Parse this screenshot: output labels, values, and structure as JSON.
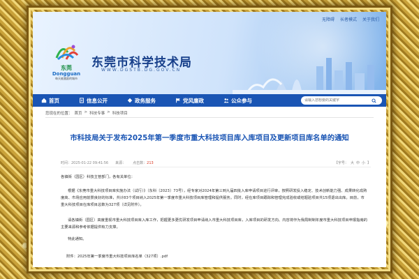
{
  "header": {
    "top_links": [
      "无障碍",
      "长者模式",
      "关于我们"
    ],
    "logo_city": "东莞",
    "logo_en": "Dongguan",
    "logo_slogan": "每天被激励的城市",
    "site_title": "东莞市科学技术局",
    "site_domain": "WWW.DGSTB.DG.GOV.CN"
  },
  "nav": {
    "items": [
      {
        "label": "首页",
        "icon": "home-icon"
      },
      {
        "label": "信息公开",
        "icon": "document-icon"
      },
      {
        "label": "政务服务",
        "icon": "service-icon"
      },
      {
        "label": "党风廉政",
        "icon": "party-flag-icon"
      },
      {
        "label": "公众参与",
        "icon": "people-icon"
      }
    ],
    "search_placeholder": "请输入您想要的关键字"
  },
  "breadcrumb": {
    "prefix": "您现在的位置：",
    "items": [
      "首页",
      "科技专事",
      "科技项目"
    ]
  },
  "article": {
    "title": "市科技局关于发布2025年第一季度市重大科技项目库入库项目及更新项目库名单的通知",
    "date_label": "时间：2025-01-22 09:41:56",
    "source_label": "来源：",
    "clicks_label": "点击数：",
    "clicks": "213",
    "font_size_label": "【字号：",
    "font_sizes": [
      "大",
      "中",
      "小"
    ],
    "font_size_close": "】",
    "paragraphs": [
      "各镇街（园区）科技主管部门，各有关单位：",
      "根据《东莞市重大科技项目库实施办法（试行）》（东科〔2023〕73号），经专家对2024年第三到九届四批入库申请项目进行评审，按照研发投入稳定、技术创新能力强、成果转化成熟度高、市场应用前景良好的标准，共计83个项目纳入2025年第一季度市重大科技项目库管理和提供服务。同时，经在库项目跟踪和管理完成验收或结题验项目共15项退出出库。目前，市重大科技项目在库项目总数为327项（详见附件）。",
      "请各镇街（园区）高度重视市重大科技项目库入库工作，把握更多更优研发项目申请纳入市重大科技项目库，入库项目的研发方向、内容将作为我局制制年度市重大科技项目申报指南的主要来源和参考依据提供有力支撑。",
      "特此通知。"
    ],
    "attachment_prefix": "附件：",
    "attachment_name": "2025年第一季度市重大科技项目库名单（327项）.pdf"
  },
  "colors": {
    "nav_bg": "#1a55b4",
    "title_blue": "#1a55b4",
    "clicks_red": "#d9331c",
    "frame_gold": "#c9a23a"
  }
}
